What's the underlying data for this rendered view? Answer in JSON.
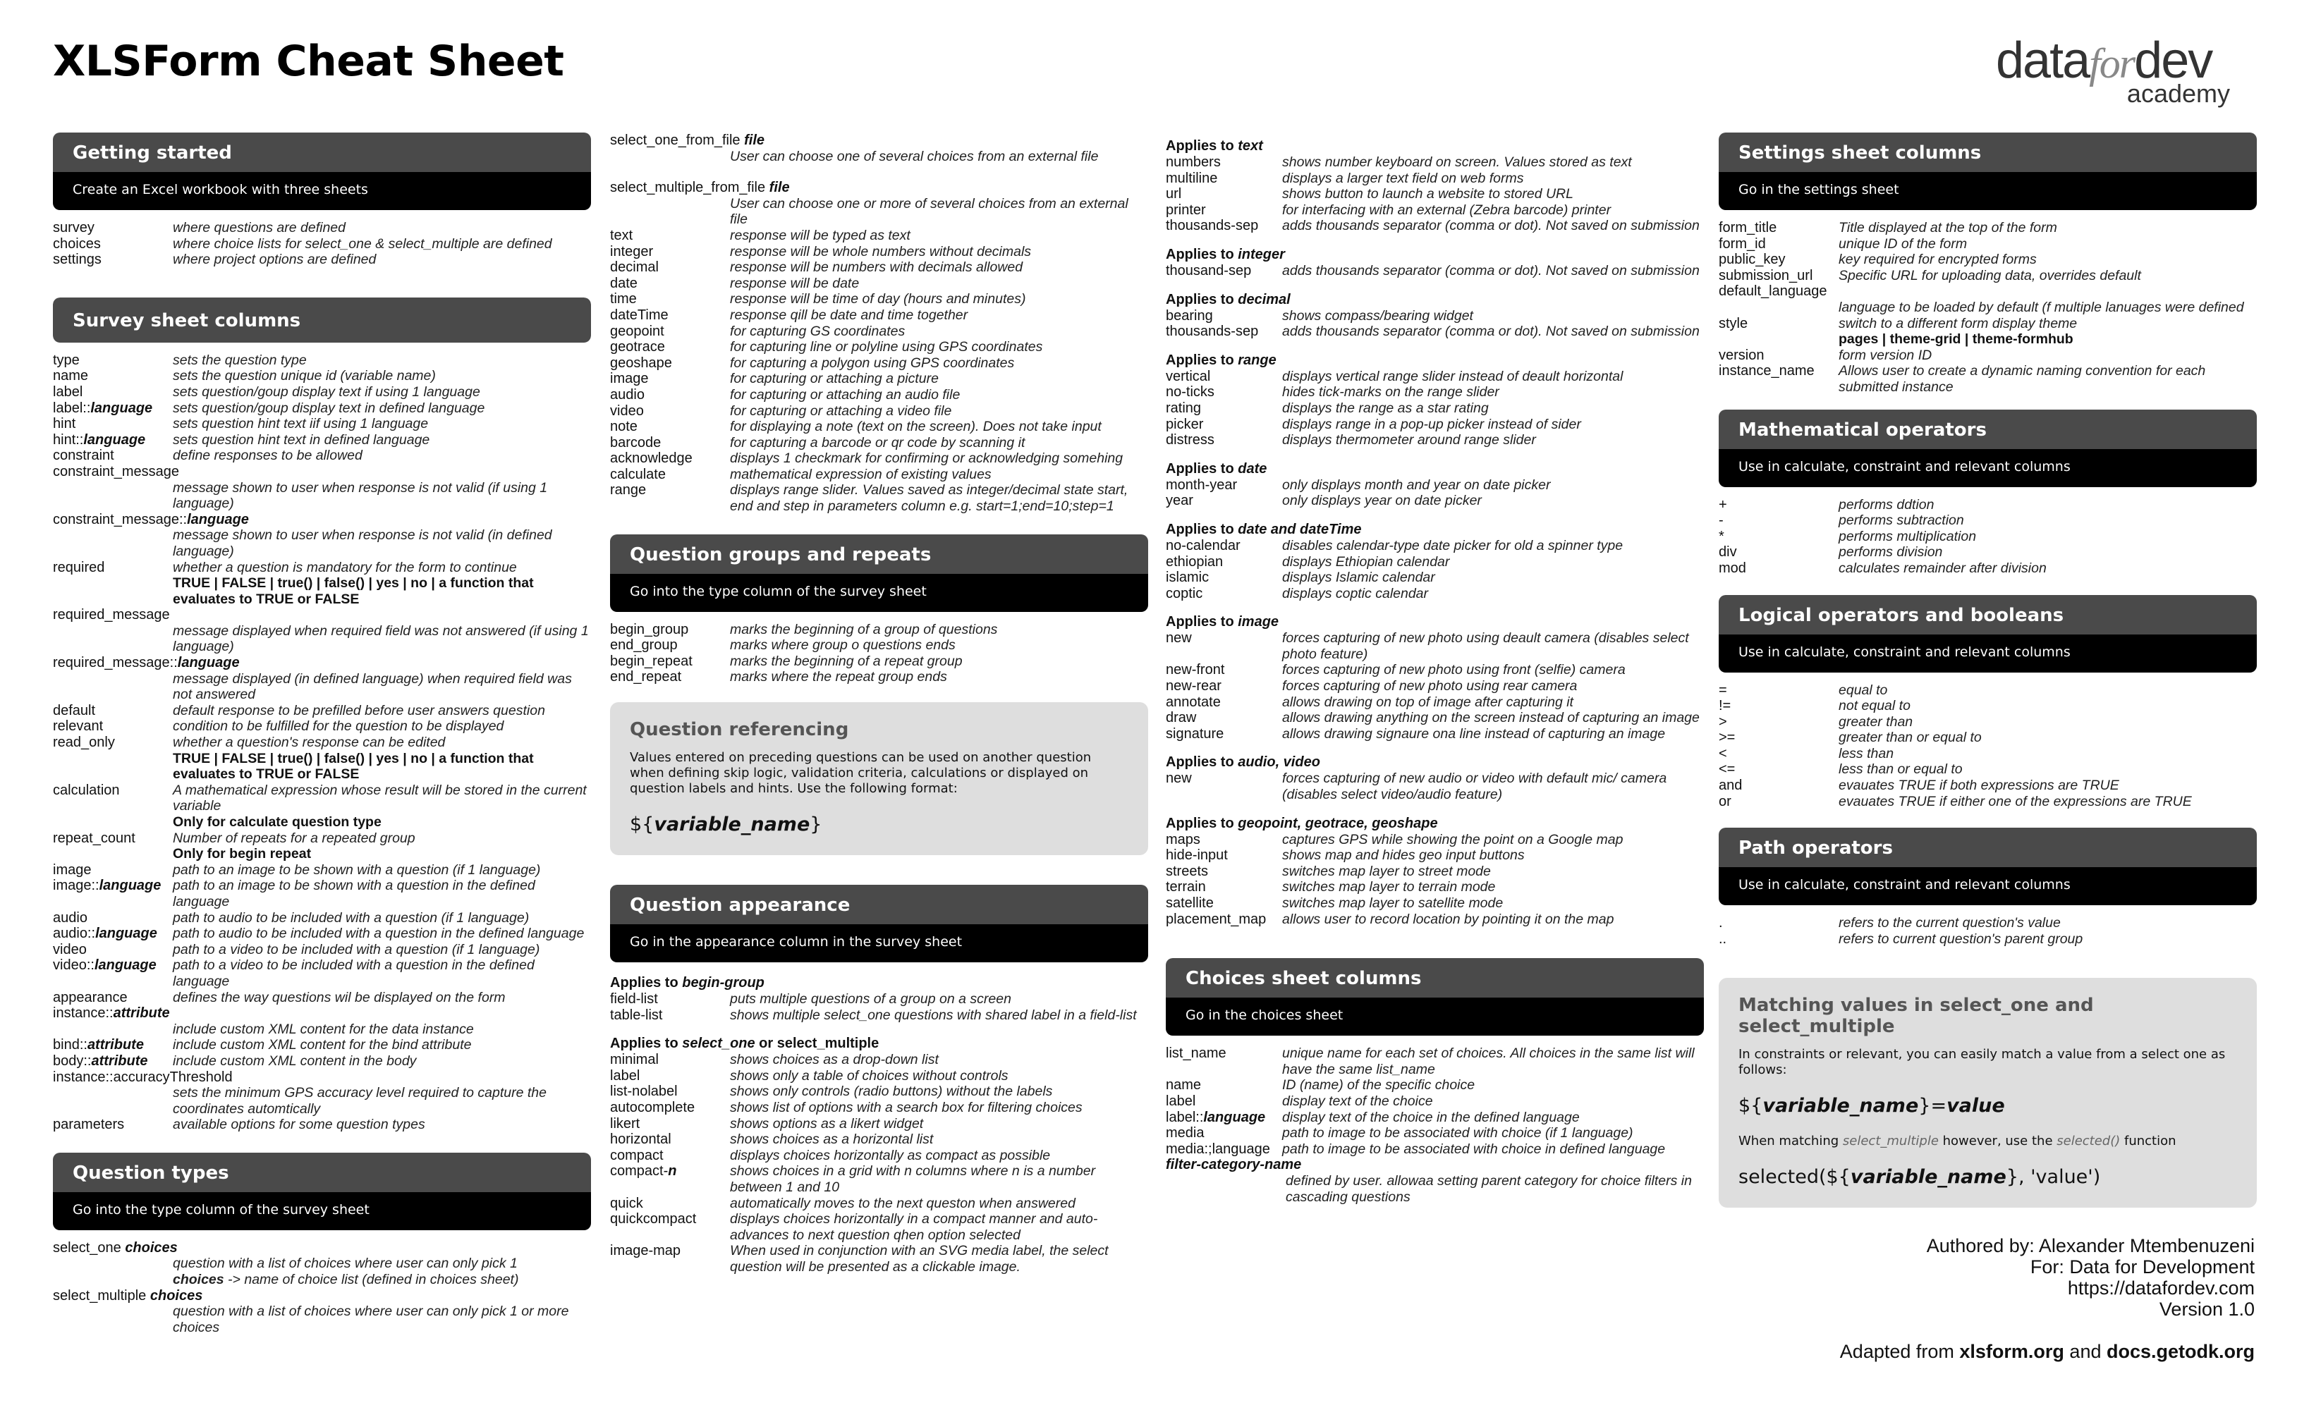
{
  "title": "XLSForm Cheat Sheet",
  "logo": {
    "part1": "data",
    "part2": "for",
    "part3": "dev",
    "sub": "academy"
  },
  "getting_started": {
    "title": "Getting started",
    "subtitle": "Create an Excel workbook with three sheets",
    "rows": [
      {
        "k": "survey",
        "v": "where questions are defined"
      },
      {
        "k": "choices",
        "v": "where choice lists for select_one & select_multiple are defined"
      },
      {
        "k": "settings",
        "v": "where project options are defined"
      }
    ]
  },
  "survey_columns": {
    "title": "Survey sheet columns",
    "rows": [
      {
        "k": "type",
        "v": "sets the question type"
      },
      {
        "k": "name",
        "v": "sets the question unique id (variable name)"
      },
      {
        "k": "label",
        "v": "sets question/goup display text if using 1 language"
      },
      {
        "k": "label::language",
        "v": "sets question/goup display text in defined language"
      },
      {
        "k": "hint",
        "v": "sets question hint text iif using 1 language"
      },
      {
        "k": "hint::language",
        "v": "sets question hint text in defined language"
      },
      {
        "k": "constraint",
        "v": "define responses to be allowed"
      },
      {
        "k": "constraint_message",
        "v": "message shown to user when response is not valid (if using 1 language)"
      },
      {
        "k": "constraint_message::language",
        "v": "message shown to user when response is not valid (in defined language)"
      },
      {
        "k": "required",
        "v": "whether a question is mandatory for the form to continue",
        "extra": "TRUE | FALSE | true() | false() | yes | no | a function that evaluates to TRUE or FALSE"
      },
      {
        "k": "required_message",
        "v": "message displayed when required field was not answered (if using 1 language)"
      },
      {
        "k": "required_message::language",
        "v": "message displayed (in defined  language) when required field was not answered"
      },
      {
        "k": "default",
        "v": "default response to be prefilled before user answers question"
      },
      {
        "k": "relevant",
        "v": "condition to be fulfilled for the question to be displayed"
      },
      {
        "k": "read_only",
        "v": "whether a question's response can be edited",
        "extra": "TRUE | FALSE | true() | false() | yes | no | a function that evaluates to TRUE or FALSE"
      },
      {
        "k": "calculation",
        "v": "A mathematical expression whose result will be stored in the current variable",
        "extra": "Only for calculate question type"
      },
      {
        "k": "repeat_count",
        "v": "Number of repeats for a repeated group",
        "extra": "Only for begin repeat"
      },
      {
        "k": "image",
        "v": "path to an image to be shown with a question (if 1 language)"
      },
      {
        "k": "image::language",
        "v": "path to an image to be shown with a question in the defined language"
      },
      {
        "k": "audio",
        "v": "path to audio to be included with a question (if 1 language)"
      },
      {
        "k": "audio::language",
        "v": "path to audio to be included with a question in the defined language"
      },
      {
        "k": "video",
        "v": "path to a video to be included with a question (if 1 language)"
      },
      {
        "k": "video::language",
        "v": "path to a video to be included with a question in the defined language"
      },
      {
        "k": "appearance",
        "v": "defines the way questions wil be displayed on the form"
      },
      {
        "k": "instance::attribute",
        "v": "include custom XML content for the data instance"
      },
      {
        "k": "bind::attribute",
        "v": "include custom XML content for the bind attribute"
      },
      {
        "k": "body::attribute",
        "v": "include custom XML content in the body"
      },
      {
        "k": "instance::accuracyThreshold",
        "v": "sets the minimum GPS accuracy level required to capture the coordinates automtically"
      },
      {
        "k": "parameters",
        "v": "available options for some question types"
      }
    ]
  },
  "question_types": {
    "title": "Question types",
    "subtitle": "Go into the type column of the survey sheet",
    "select_one": {
      "k": "select_one",
      "kv": "choices",
      "v": "question with a list of choices where user can only pick 1",
      "note_k": "choices",
      "note_v": "-> name of choice list (defined in choices sheet)"
    },
    "select_multiple": {
      "k": "select_multiple",
      "kv": "choices",
      "v": "question with a list of choices where user can only pick 1 or more choices"
    },
    "select_one_from_file": {
      "k": "select_one_from_file",
      "kv": "file",
      "v": "User can choose one of several choices from an external file"
    },
    "select_multiple_from_file": {
      "k": "select_multiple_from_file",
      "kv": "file",
      "v": "User can choose one or more of several choices from an external file"
    },
    "rows": [
      {
        "k": "text",
        "v": "response will be typed as text"
      },
      {
        "k": "integer",
        "v": "response will be whole numbers without decimals"
      },
      {
        "k": "decimal",
        "v": "response will be numbers with decimals allowed"
      },
      {
        "k": "date",
        "v": "response will be date"
      },
      {
        "k": "time",
        "v": "response will be time of day (hours and minutes)"
      },
      {
        "k": "dateTime",
        "v": "response qill be date and time together"
      },
      {
        "k": "geopoint",
        "v": "for capturing GS coordinates"
      },
      {
        "k": "geotrace",
        "v": "for capturing  line or polyline using GPS coordinates"
      },
      {
        "k": "geoshape",
        "v": "for capturing a polygon using GPS coordinates"
      },
      {
        "k": "image",
        "v": "for capturing or attaching a picture"
      },
      {
        "k": "audio",
        "v": "for capturing or attaching an audio file"
      },
      {
        "k": "video",
        "v": "for capturing or attaching a video file"
      },
      {
        "k": "note",
        "v": "for displaying a note (text on the screen). Does not take input"
      },
      {
        "k": "barcode",
        "v": "for capturing a barcode or qr code by scanning it"
      },
      {
        "k": "acknowledge",
        "v": "displays 1 checkmark for confirming or acknowledging somehing"
      },
      {
        "k": "calculate",
        "v": "mathematical expression of existing values"
      },
      {
        "k": "range",
        "v": "displays range slider. Values saved as integer/decimal state start, end and step in parameters column e.g. start=1;end=10;step=1"
      }
    ]
  },
  "groups": {
    "title": "Question groups and repeats",
    "subtitle": "Go into the type column of the survey sheet",
    "rows": [
      {
        "k": "begin_group",
        "v": "marks the beginning of a group of questions"
      },
      {
        "k": "end_group",
        "v": "marks where group o questions ends"
      },
      {
        "k": "begin_repeat",
        "v": "marks the beginning of a repeat group"
      },
      {
        "k": "end_repeat",
        "v": "marks where the repeat group ends"
      }
    ]
  },
  "referencing": {
    "title": "Question referencing",
    "text": "Values entered on preceding questions can be used on another question when defining skip logic, validation criteria, calculations or displayed on question labels and hints. Use the following format:",
    "code_prefix": "${",
    "code_var": "variable_name",
    "code_suffix": "}"
  },
  "appearance": {
    "title": "Question appearance",
    "subtitle": "Go in the appearance column in the survey sheet",
    "groups": [
      {
        "prefix": "Applies to ",
        "target": "begin-group",
        "rows": [
          {
            "k": "field-list",
            "v": "puts multiple questions of a group on a screen"
          },
          {
            "k": "table-list",
            "v": "shows multiple select_one questions with shared label in a field-list"
          }
        ]
      },
      {
        "prefix": "Applies to ",
        "target": "select_one",
        "suffix": " or select_multiple",
        "rows": [
          {
            "k": "minimal",
            "v": "shows choices as a drop-down list"
          },
          {
            "k": "label",
            "v": "shows only a table of choices without controls"
          },
          {
            "k": "list-nolabel",
            "v": "shows only controls (radio buttons) without the labels"
          },
          {
            "k": "autocomplete",
            "v": "shows list of options with a search box for filtering choices"
          },
          {
            "k": "likert",
            "v": "shows options as a likert widget"
          },
          {
            "k": "horizontal",
            "v": "shows choices as a horizontal list"
          },
          {
            "k": "compact",
            "v": "displays choices horizontally as compact as possible"
          },
          {
            "k": "compact-n",
            "v": "shows choices in a grid with n columns where n is a number between 1 and 10"
          },
          {
            "k": "quick",
            "v": "automatically moves to the next queston when answered"
          },
          {
            "k": "quickcompact",
            "v": "displays choices horizontally in a compact manner and auto-advances to next question qhen option selected"
          },
          {
            "k": "image-map",
            "v": "When used in conjunction with an SVG media label, the select question will be presented as a clickable image."
          }
        ]
      },
      {
        "prefix": "Applies to ",
        "target": "text",
        "rows": [
          {
            "k": "numbers",
            "v": "shows number keyboard on screen. Values stored as text"
          },
          {
            "k": "multiline",
            "v": "displays a larger text field on web forms"
          },
          {
            "k": "url",
            "v": "shows button to launch a website to stored URL"
          },
          {
            "k": "printer",
            "v": "for interfacing with an external (Zebra barcode) printer"
          },
          {
            "k": "thousands-sep",
            "v": "adds thousands separator (comma or dot). Not saved on submission"
          }
        ]
      },
      {
        "prefix": "Applies to ",
        "target": "integer",
        "rows": [
          {
            "k": "thousand-sep",
            "v": "adds thousands separator (comma or dot). Not saved on submission"
          }
        ]
      },
      {
        "prefix": "Applies to ",
        "target": "decimal",
        "rows": [
          {
            "k": "bearing",
            "v": "shows compass/bearing widget"
          },
          {
            "k": "thousands-sep",
            "v": "adds thousands separator (comma or dot). Not saved on submission"
          }
        ]
      },
      {
        "prefix": "Applies to ",
        "target": "range",
        "rows": [
          {
            "k": "vertical",
            "v": "displays vertical range slider instead of deault horizontal"
          },
          {
            "k": "no-ticks",
            "v": "hides tick-marks on the range slider"
          },
          {
            "k": "rating",
            "v": "displays the range as a star rating"
          },
          {
            "k": "picker",
            "v": "displays range in a pop-up picker instead of sider"
          },
          {
            "k": "distress",
            "v": "displays thermometer around range slider"
          }
        ]
      },
      {
        "prefix": "Applies to ",
        "target": "date",
        "rows": [
          {
            "k": "month-year",
            "v": "only displays month and year on date picker"
          },
          {
            "k": "year",
            "v": "only displays year on date picker"
          }
        ]
      },
      {
        "prefix": "Applies to ",
        "target": "date and dateTime",
        "rows": [
          {
            "k": "no-calendar",
            "v": "disables calendar-type date picker for old a spinner type"
          },
          {
            "k": "ethiopian",
            "v": "displays Ethiopian calendar"
          },
          {
            "k": "islamic",
            "v": "displays Islamic calendar"
          },
          {
            "k": "coptic",
            "v": "displays coptic calendar"
          }
        ]
      },
      {
        "prefix": "Applies to ",
        "target": "image",
        "rows": [
          {
            "k": "new",
            "v": "forces capturing of new photo using deault camera (disables select photo feature)"
          },
          {
            "k": "new-front",
            "v": "forces capturing of new photo using front (selfie) camera"
          },
          {
            "k": "new-rear",
            "v": "forces capturing of new photo using rear camera"
          },
          {
            "k": "annotate",
            "v": "allows drawing on top of image after capturing it"
          },
          {
            "k": "draw",
            "v": "allows drawing anything on the screen instead of capturing an image"
          },
          {
            "k": "signature",
            "v": "allows drawing signaure ona line instead of capturing an image"
          }
        ]
      },
      {
        "prefix": "Applies to ",
        "target": "audio, video",
        "rows": [
          {
            "k": "new",
            "v": "forces capturing of new audio or video with default mic/ camera (disables select video/audio feature)"
          }
        ]
      },
      {
        "prefix": "Applies to ",
        "target": "geopoint, geotrace, geoshape",
        "rows": [
          {
            "k": "maps",
            "v": "captures GPS while showing the point on a Google map"
          },
          {
            "k": "hide-input",
            "v": "shows map and hides geo input buttons"
          },
          {
            "k": "streets",
            "v": "switches map layer to street mode"
          },
          {
            "k": "terrain",
            "v": "switches map layer to terrain mode"
          },
          {
            "k": "satellite",
            "v": "switches map layer to satellite mode"
          },
          {
            "k": "placement_map",
            "v": "allows user to record location by pointing it on the map"
          }
        ]
      }
    ]
  },
  "choices_columns": {
    "title": "Choices sheet columns",
    "subtitle": "Go in the choices sheet",
    "rows": [
      {
        "k": "list_name",
        "v": "unique name for each set of choices. All choices in the same list will have the same list_name"
      },
      {
        "k": "name",
        "v": "ID (name) of the specific choice"
      },
      {
        "k": "label",
        "v": "display text of the choice"
      },
      {
        "k": "label::language",
        "v": "display text of the choice in the defined language"
      },
      {
        "k": "media",
        "v": "path to image to be associated with choice (if 1 language)"
      },
      {
        "k": "media:;language",
        "v": "path to image to be associated with choice in defined language"
      },
      {
        "k": "filter-category-name",
        "v": "defined by user. allowaa setting parent category for choice filters in cascading questions"
      }
    ]
  },
  "settings_columns": {
    "title": "Settings sheet columns",
    "subtitle": "Go in the settings sheet",
    "rows": [
      {
        "k": "form_title",
        "v": "Title displayed at the top of the form"
      },
      {
        "k": "form_id",
        "v": "unique ID of the form"
      },
      {
        "k": "public_key",
        "v": "key required for encrypted forms"
      },
      {
        "k": "submission_url",
        "v": "Specific URL for uploading data, overrides default"
      },
      {
        "k": "default_language",
        "v": "language to be loaded by default (f multiple lanuages were defined"
      },
      {
        "k": "style",
        "v": "switch to a different form display theme",
        "extra": "pages | theme-grid | theme-formhub"
      },
      {
        "k": "version",
        "v": "form version ID"
      },
      {
        "k": "instance_name",
        "v": "Allows user to create a dynamic naming convention for each submitted instance"
      }
    ]
  },
  "math_ops": {
    "title": "Mathematical operators",
    "subtitle": "Use in calculate, constraint and relevant columns",
    "rows": [
      {
        "k": "+",
        "v": "performs ddtion"
      },
      {
        "k": "-",
        "v": "performs subtraction"
      },
      {
        "k": "*",
        "v": "performs multiplication"
      },
      {
        "k": "div",
        "v": "performs division"
      },
      {
        "k": "mod",
        "v": "calculates remainder after division"
      }
    ]
  },
  "logic_ops": {
    "title": "Logical operators and booleans",
    "subtitle": "Use in calculate, constraint and relevant columns",
    "rows": [
      {
        "k": "=",
        "v": "equal to"
      },
      {
        "k": "!=",
        "v": "not equal to"
      },
      {
        "k": ">",
        "v": "greater than"
      },
      {
        "k": ">=",
        "v": "greater than or equal to"
      },
      {
        "k": "<",
        "v": "less than"
      },
      {
        "k": "<=",
        "v": "less than or equal to"
      },
      {
        "k": "and",
        "v": "evauates TRUE if both expressions are TRUE"
      },
      {
        "k": "or",
        "v": "evauates TRUE if either one of the expressions are TRUE"
      }
    ]
  },
  "path_ops": {
    "title": "Path operators",
    "subtitle": "Use in calculate, constraint and relevant columns",
    "rows": [
      {
        "k": ".",
        "v": "refers to the current question's value"
      },
      {
        "k": "..",
        "v": "refers to current question's parent group"
      }
    ]
  },
  "matching": {
    "title": "Matching values in select_one and select_multiple",
    "text": "In constraints or relevant, you can easily match a value from a select one as follows:",
    "code1_prefix": "${",
    "code1_var": "variable_name",
    "code1_suffix": "}=",
    "code1_value": "value",
    "text2_a": "When matching ",
    "text2_b": "select_multiple",
    "text2_c": " however, use the ",
    "text2_d": "selected()",
    "text2_e": " function",
    "code2_prefix": "selected(${",
    "code2_var": "variable_name",
    "code2_suffix": "}, 'value')"
  },
  "credits": {
    "author": "Authored by: Alexander Mtembenuzeni",
    "for": "For: Data for Development",
    "url": "https://datafordev.com",
    "version": "Version 1.0",
    "adapted_prefix": "Adapted from ",
    "adapted_src1": "xlsform.org",
    "adapted_and": " and ",
    "adapted_src2": "docs.getodk.org"
  }
}
